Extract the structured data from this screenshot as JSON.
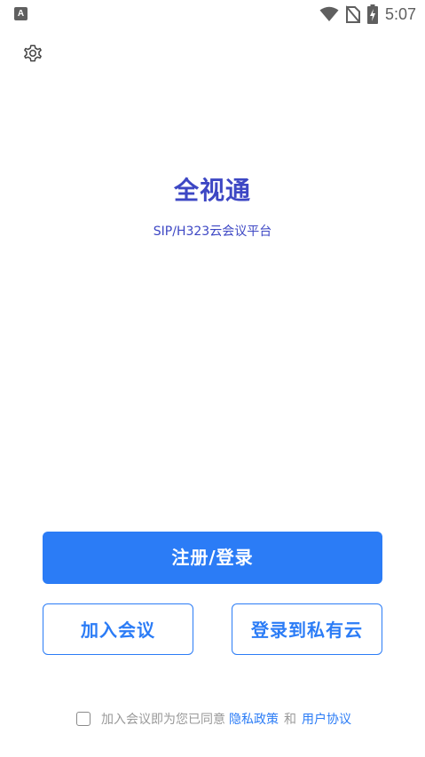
{
  "status_bar": {
    "left_icon_letter": "A",
    "time": "5:07",
    "icons": [
      "wifi-icon",
      "no-sim-icon",
      "battery-charging-icon"
    ]
  },
  "settings": {
    "icon": "gear-icon"
  },
  "app": {
    "title": "全视通",
    "subtitle": "SIP/H323云会议平台"
  },
  "buttons": {
    "register_login": "注册/登录",
    "join_meeting": "加入会议",
    "login_private_cloud": "登录到私有云"
  },
  "agreement": {
    "checked": false,
    "prefix": "加入会议即为您已同意",
    "privacy_link": "隐私政策",
    "and": "和",
    "terms_link": "用户协议"
  },
  "colors": {
    "accent": "#2b7cf6",
    "title": "#3d47c4"
  }
}
